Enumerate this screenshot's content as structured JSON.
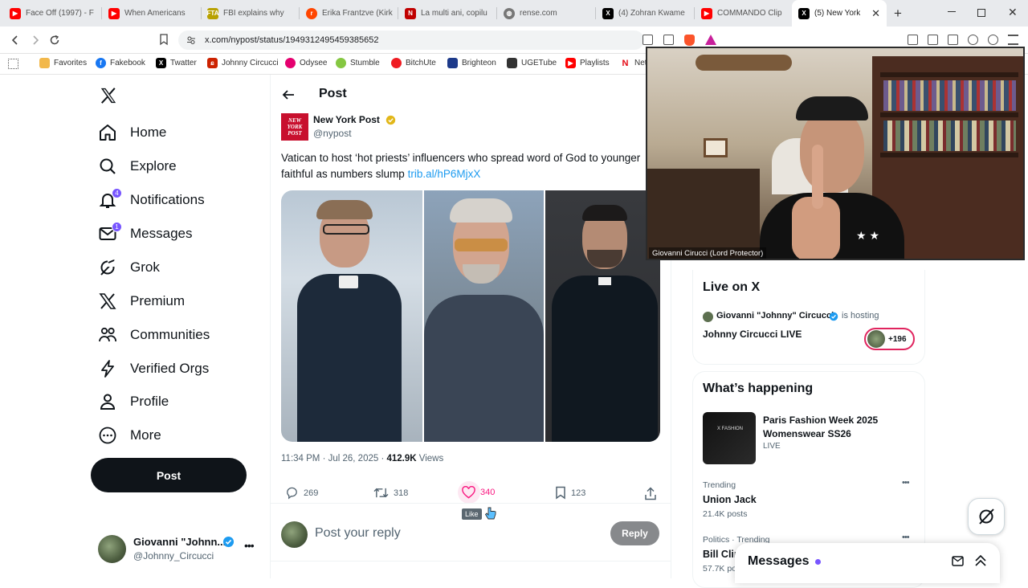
{
  "browser": {
    "tabs": [
      {
        "title": "Face Off (1997) - F",
        "icon": "youtube",
        "color": "#ff0000"
      },
      {
        "title": "When Americans",
        "icon": "youtube",
        "color": "#ff0000"
      },
      {
        "title": "FBI explains why",
        "icon": "fta",
        "color": "#b8a100"
      },
      {
        "title": "Erika Frantzve (Kirk",
        "icon": "reddit",
        "color": "#ff4500"
      },
      {
        "title": "La multi ani, copilu",
        "icon": "news",
        "color": "#c00000"
      },
      {
        "title": "rense.com",
        "icon": "globe",
        "color": "#777777"
      },
      {
        "title": "(4) Zohran Kwame",
        "icon": "x",
        "color": "#000000"
      },
      {
        "title": "COMMANDO Clip",
        "icon": "youtube",
        "color": "#ff0000"
      },
      {
        "title": "(5) New York",
        "icon": "x",
        "color": "#000000"
      }
    ],
    "url": "x.com/nypost/status/1949312495459385652",
    "bookmarks": [
      {
        "label": "Favorites",
        "icon": "folder",
        "color": "#f2b84b"
      },
      {
        "label": "Fakebook",
        "icon": "facebook",
        "color": "#1877f2"
      },
      {
        "label": "Twatter",
        "icon": "x",
        "color": "#000000"
      },
      {
        "label": "Johnny Circucci",
        "icon": "tw",
        "color": "#cc2200"
      },
      {
        "label": "Odysee",
        "icon": "odysee",
        "color": "#e5006f"
      },
      {
        "label": "Stumble",
        "icon": "stumble",
        "color": "#85c742"
      },
      {
        "label": "BitchUte",
        "icon": "bitchute",
        "color": "#ef1c22"
      },
      {
        "label": "Brighteon",
        "icon": "brighteon",
        "color": "#1d3a8a"
      },
      {
        "label": "UGETube",
        "icon": "ugetube",
        "color": "#333333"
      },
      {
        "label": "Playlists",
        "icon": "youtube",
        "color": "#ff0000"
      },
      {
        "label": "Net",
        "icon": "netflix",
        "color": "#e50914"
      }
    ]
  },
  "sidebar": {
    "items": [
      {
        "label": "Home",
        "icon": "home-icon"
      },
      {
        "label": "Explore",
        "icon": "search-icon"
      },
      {
        "label": "Notifications",
        "icon": "bell-icon",
        "badge": "4"
      },
      {
        "label": "Messages",
        "icon": "mail-icon",
        "badge": "1"
      },
      {
        "label": "Grok",
        "icon": "grok-icon"
      },
      {
        "label": "Premium",
        "icon": "x-icon"
      },
      {
        "label": "Communities",
        "icon": "communities-icon"
      },
      {
        "label": "Verified Orgs",
        "icon": "lightning-icon"
      },
      {
        "label": "Profile",
        "icon": "person-icon"
      },
      {
        "label": "More",
        "icon": "more-circle-icon"
      }
    ],
    "post_button": "Post",
    "account": {
      "name": "Giovanni \"Johnn...",
      "handle": "@Johnny_Circucci"
    }
  },
  "post": {
    "header": "Post",
    "author_name": "New York Post",
    "author_handle": "@nypost",
    "avatar_text": "NEW YORK POST",
    "text": "Vatican to host ‘hot priests’ influencers who spread word of God to younger faithful as numbers slump",
    "link": "trib.al/hP6MjxX",
    "time": "11:34 PM · Jul 26, 2025 · ",
    "views_count": "412.9K",
    "views_label": " Views",
    "replies": "269",
    "reposts": "318",
    "likes": "340",
    "bookmarks": "123",
    "like_tooltip": "Like",
    "reply_placeholder": "Post your reply",
    "reply_button": "Reply"
  },
  "live": {
    "title": "Live on X",
    "host": "Giovanni \"Johnny\" Circucci",
    "hosting": " is hosting",
    "show": "Johnny Circucci LIVE",
    "listeners": "+196"
  },
  "trends": {
    "title": "What’s happening",
    "featured_title": "Paris Fashion Week 2025 Womenswear SS26",
    "featured_status": "LIVE",
    "featured_thumb": "X FASHION",
    "items": [
      {
        "context": "Trending",
        "name": "Union Jack",
        "count": "21.4K posts"
      },
      {
        "context": "Politics · Trending",
        "name": "Bill Clin",
        "count": "57.7K po"
      }
    ]
  },
  "messages_drawer": {
    "title": "Messages"
  },
  "video": {
    "caption": "Giovanni Cirucci (Lord Protector)"
  },
  "colors": {
    "accent": "#1d9bf0",
    "like": "#f91880",
    "link": "#1d9bf0",
    "badge": "#7856ff",
    "verified_gold": "#e2b719"
  }
}
